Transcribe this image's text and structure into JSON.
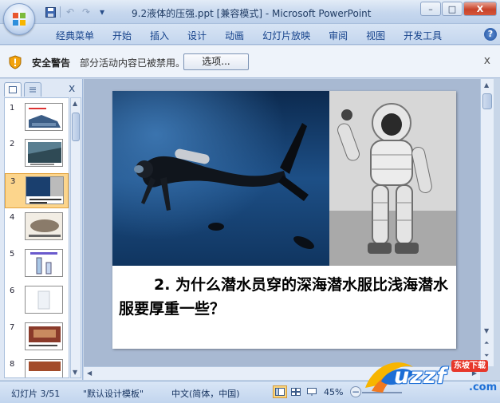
{
  "window": {
    "title": "9.2液体的压强.ppt [兼容模式] - Microsoft PowerPoint",
    "controls": [
      "–",
      "□",
      "X"
    ]
  },
  "quick_access": {
    "icons": [
      "save-icon",
      "undo-icon",
      "redo-icon",
      "customize-icon"
    ]
  },
  "ribbon": {
    "tabs": [
      "经典菜单",
      "开始",
      "插入",
      "设计",
      "动画",
      "幻灯片放映",
      "审阅",
      "视图",
      "开发工具"
    ],
    "help_label": "?"
  },
  "message_bar": {
    "title": "安全警告",
    "text": "部分活动内容已被禁用。",
    "options_label": "选项...",
    "close_label": "x"
  },
  "left_pane": {
    "close_label": "x",
    "slides": [
      {
        "num": "1",
        "selected": false
      },
      {
        "num": "2",
        "selected": false
      },
      {
        "num": "3",
        "selected": true
      },
      {
        "num": "4",
        "selected": false
      },
      {
        "num": "5",
        "selected": false
      },
      {
        "num": "6",
        "selected": false
      },
      {
        "num": "7",
        "selected": false
      },
      {
        "num": "8",
        "selected": false
      }
    ]
  },
  "slide": {
    "question": "2. 为什么潜水员穿的深海潜水服比浅海潜水服要厚重一些？"
  },
  "status_bar": {
    "slide_info": "幻灯片 3/51",
    "template": "\"默认设计模板\"",
    "language": "中文(简体，中国)",
    "zoom": "45%"
  },
  "watermark": {
    "text": "uzzf",
    "badge": "东坡下载",
    "suffix": ".com"
  },
  "colors": {
    "accent": "#15428b",
    "selected_thumb": "#fcd58c",
    "close_button": "#c8432a"
  }
}
